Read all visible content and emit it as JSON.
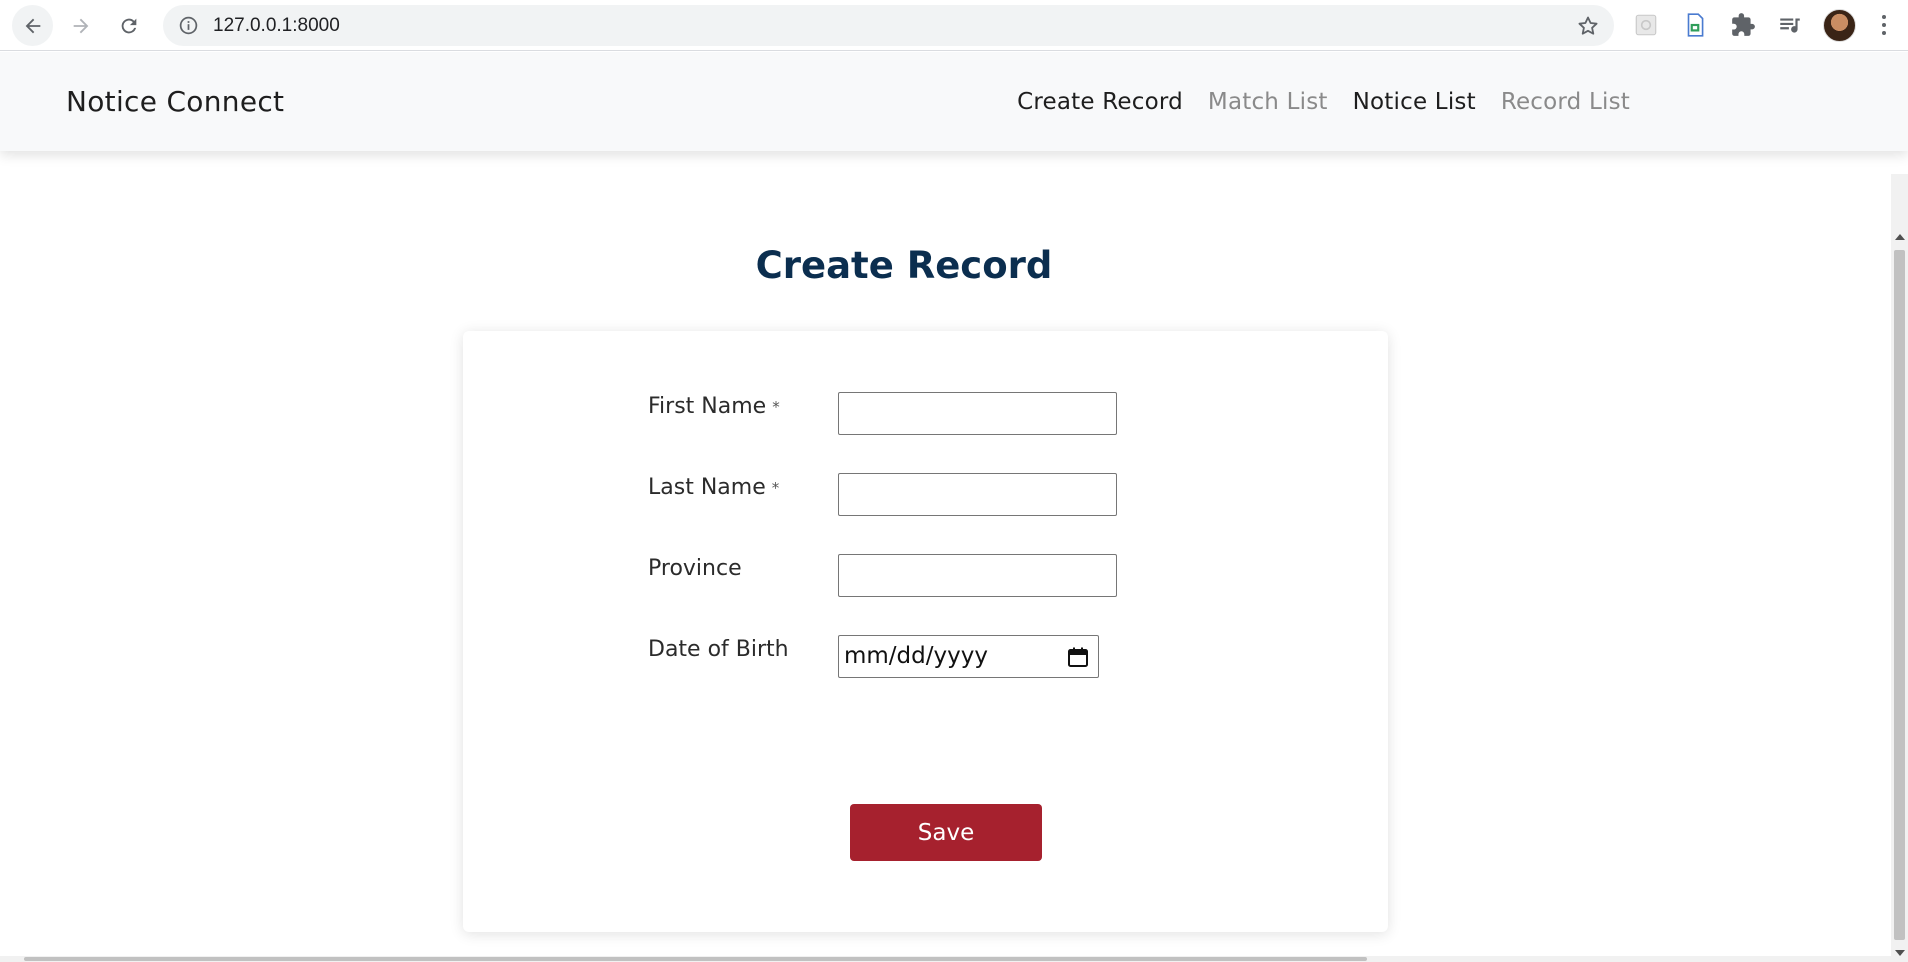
{
  "browser": {
    "url": "127.0.0.1:8000"
  },
  "navbar": {
    "brand": "Notice Connect",
    "links": [
      {
        "label": "Create Record",
        "state": "active"
      },
      {
        "label": "Match List",
        "state": "muted"
      },
      {
        "label": "Notice List",
        "state": "active"
      },
      {
        "label": "Record List",
        "state": "muted"
      }
    ]
  },
  "page": {
    "title": "Create Record"
  },
  "form": {
    "fields": [
      {
        "label": "First Name",
        "required_mark": "*",
        "value": ""
      },
      {
        "label": "Last Name",
        "required_mark": "*",
        "value": ""
      },
      {
        "label": "Province",
        "required_mark": "",
        "value": ""
      },
      {
        "label": "Date of Birth",
        "required_mark": "",
        "value": "mm/dd/yyyy"
      }
    ],
    "save_label": "Save"
  },
  "colors": {
    "title": "#0b2e4f",
    "save_button": "#a6212e",
    "navbar_bg": "#f8f9fa",
    "nav_muted": "#8a8a8a"
  }
}
